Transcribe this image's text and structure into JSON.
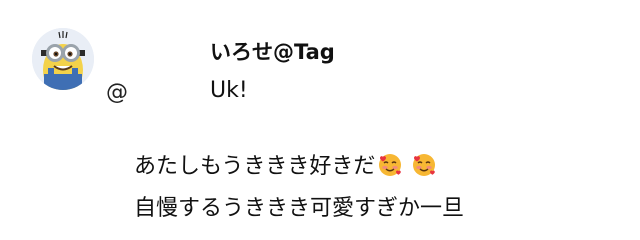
{
  "post": {
    "username": "いろせ@Tag",
    "mention_label": "@",
    "reply_text": "Uk!",
    "line1_text": "あたしもうききき好きだ",
    "line2_text": "自慢するうききき可愛すぎか一旦"
  },
  "icons": {
    "avatar": "minion-avatar",
    "emoji1": "smiling-face-with-hearts-emoji",
    "emoji2": "smiling-face-with-hearts-emoji"
  },
  "colors": {
    "background": "#ffffff",
    "text": "#111111",
    "emoji_face": "#f7b733",
    "emoji_heart": "#e8343f",
    "emoji_blush": "#f38b7a"
  }
}
